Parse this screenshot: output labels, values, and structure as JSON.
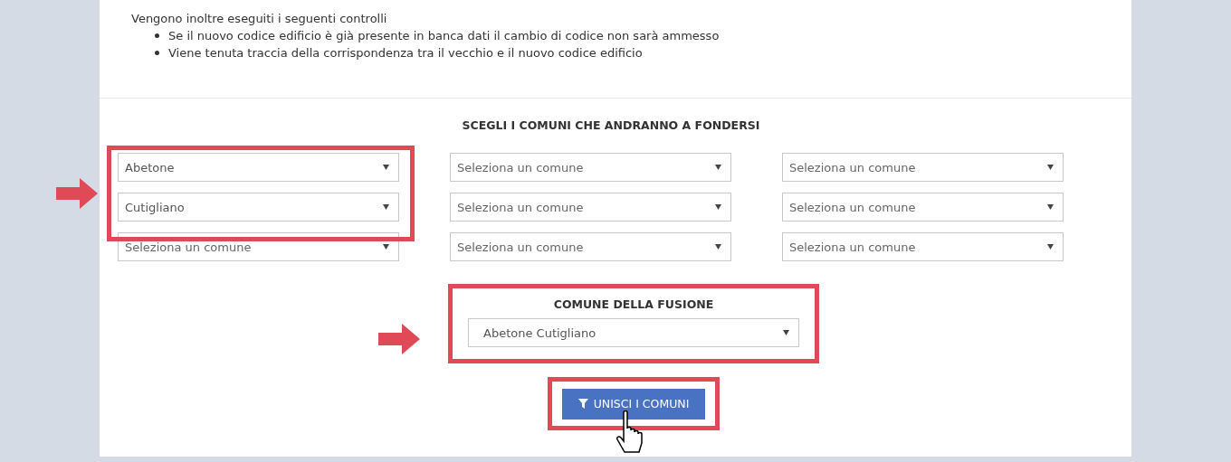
{
  "intro": {
    "text": "Vengono inoltre eseguiti i seguenti controlli",
    "bullets": [
      "Se il nuovo codice edificio è già presente in banca dati il cambio di codice non sarà ammesso",
      "Viene tenuta traccia della corrispondenza tra il vecchio e il nuovo codice edificio"
    ]
  },
  "merge_section": {
    "title": "SCEGLI I COMUNI CHE ANDRANNO A FONDERSI",
    "selects": [
      {
        "value": "Abetone"
      },
      {
        "placeholder": "Seleziona un comune"
      },
      {
        "placeholder": "Seleziona un comune"
      },
      {
        "value": "Cutigliano"
      },
      {
        "placeholder": "Seleziona un comune"
      },
      {
        "placeholder": "Seleziona un comune"
      },
      {
        "placeholder": "Seleziona un comune"
      },
      {
        "placeholder": "Seleziona un comune"
      },
      {
        "placeholder": "Seleziona un comune"
      }
    ]
  },
  "fusion": {
    "title": "COMUNE DELLA FUSIONE",
    "select": {
      "value": "Abetone Cutigliano"
    }
  },
  "button": {
    "label": "UNISCI I COMUNI"
  }
}
